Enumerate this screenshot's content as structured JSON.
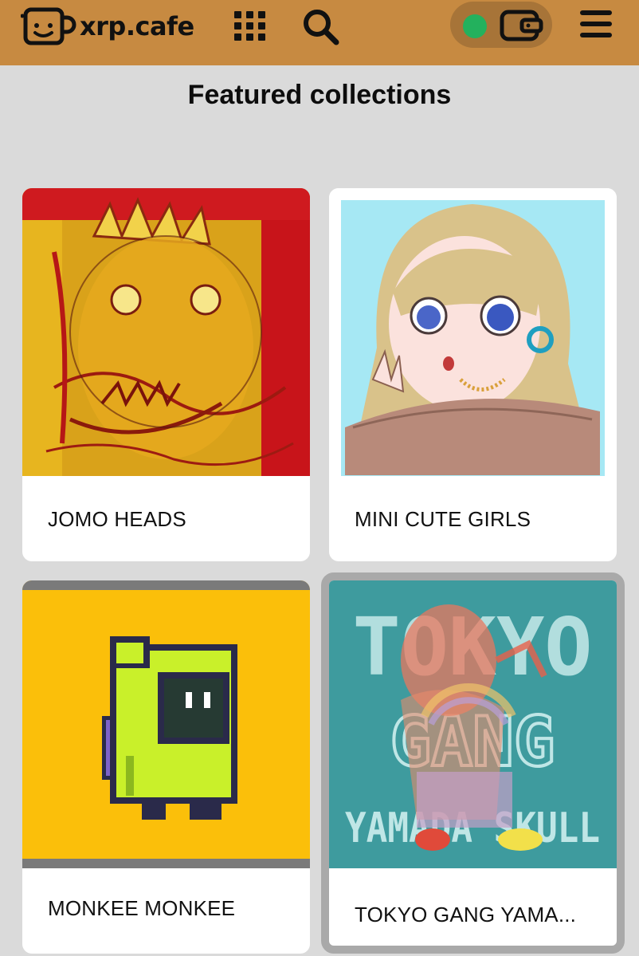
{
  "header": {
    "brand": "xrp.cafe",
    "colors": {
      "bar": "#c78a41",
      "pill": "#a77438",
      "status": "#23b15d"
    },
    "icons": [
      "mug-logo-icon",
      "apps-grid-icon",
      "search-icon",
      "wallet-icon",
      "menu-icon"
    ]
  },
  "page": {
    "title": "Featured collections"
  },
  "collections": [
    {
      "name": "JOMO HEADS"
    },
    {
      "name": "MINI CUTE GIRLS"
    },
    {
      "name": "MONKEE MONKEE"
    },
    {
      "name": "TOKYO GANG YAMA..."
    }
  ],
  "artwork_text": {
    "tokyo": {
      "line1": "TOKYO",
      "line2": "GANG",
      "line3": "YAMADA SKULL"
    }
  }
}
